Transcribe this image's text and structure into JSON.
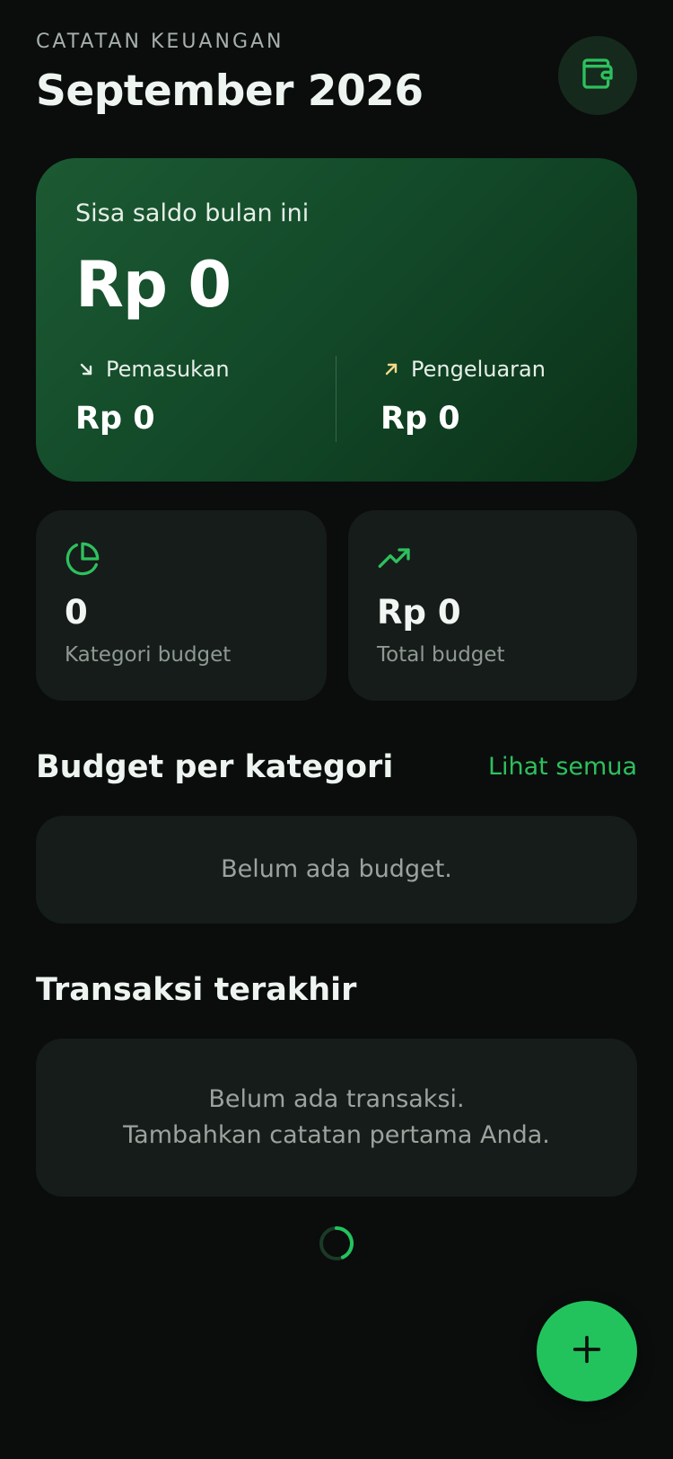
{
  "header": {
    "eyebrow": "CATATAN KEUANGAN",
    "title": "September 2026",
    "wallet_icon": "wallet-icon"
  },
  "balance": {
    "label": "Sisa saldo bulan ini",
    "amount": "Rp 0",
    "income": {
      "label": "Pemasukan",
      "value": "Rp 0",
      "icon": "arrow-down-right-icon",
      "icon_color": "#e6efe8"
    },
    "expense": {
      "label": "Pengeluaran",
      "value": "Rp 0",
      "icon": "arrow-up-right-icon",
      "icon_color": "#f2d98a"
    }
  },
  "stats": [
    {
      "icon": "pie-chart-icon",
      "value": "0",
      "label": "Kategori budget"
    },
    {
      "icon": "trending-up-icon",
      "value": "Rp 0",
      "label": "Total budget"
    }
  ],
  "budget_section": {
    "title": "Budget per kategori",
    "link": "Lihat semua",
    "empty": "Belum ada budget."
  },
  "transactions_section": {
    "title": "Transaksi terakhir",
    "empty_line1": "Belum ada transaksi.",
    "empty_line2": "Tambahkan catatan pertama Anda."
  },
  "fab": {
    "icon": "plus-icon"
  },
  "colors": {
    "accent": "#22c35d",
    "background": "#0a0d0c",
    "card": "#161c19"
  }
}
